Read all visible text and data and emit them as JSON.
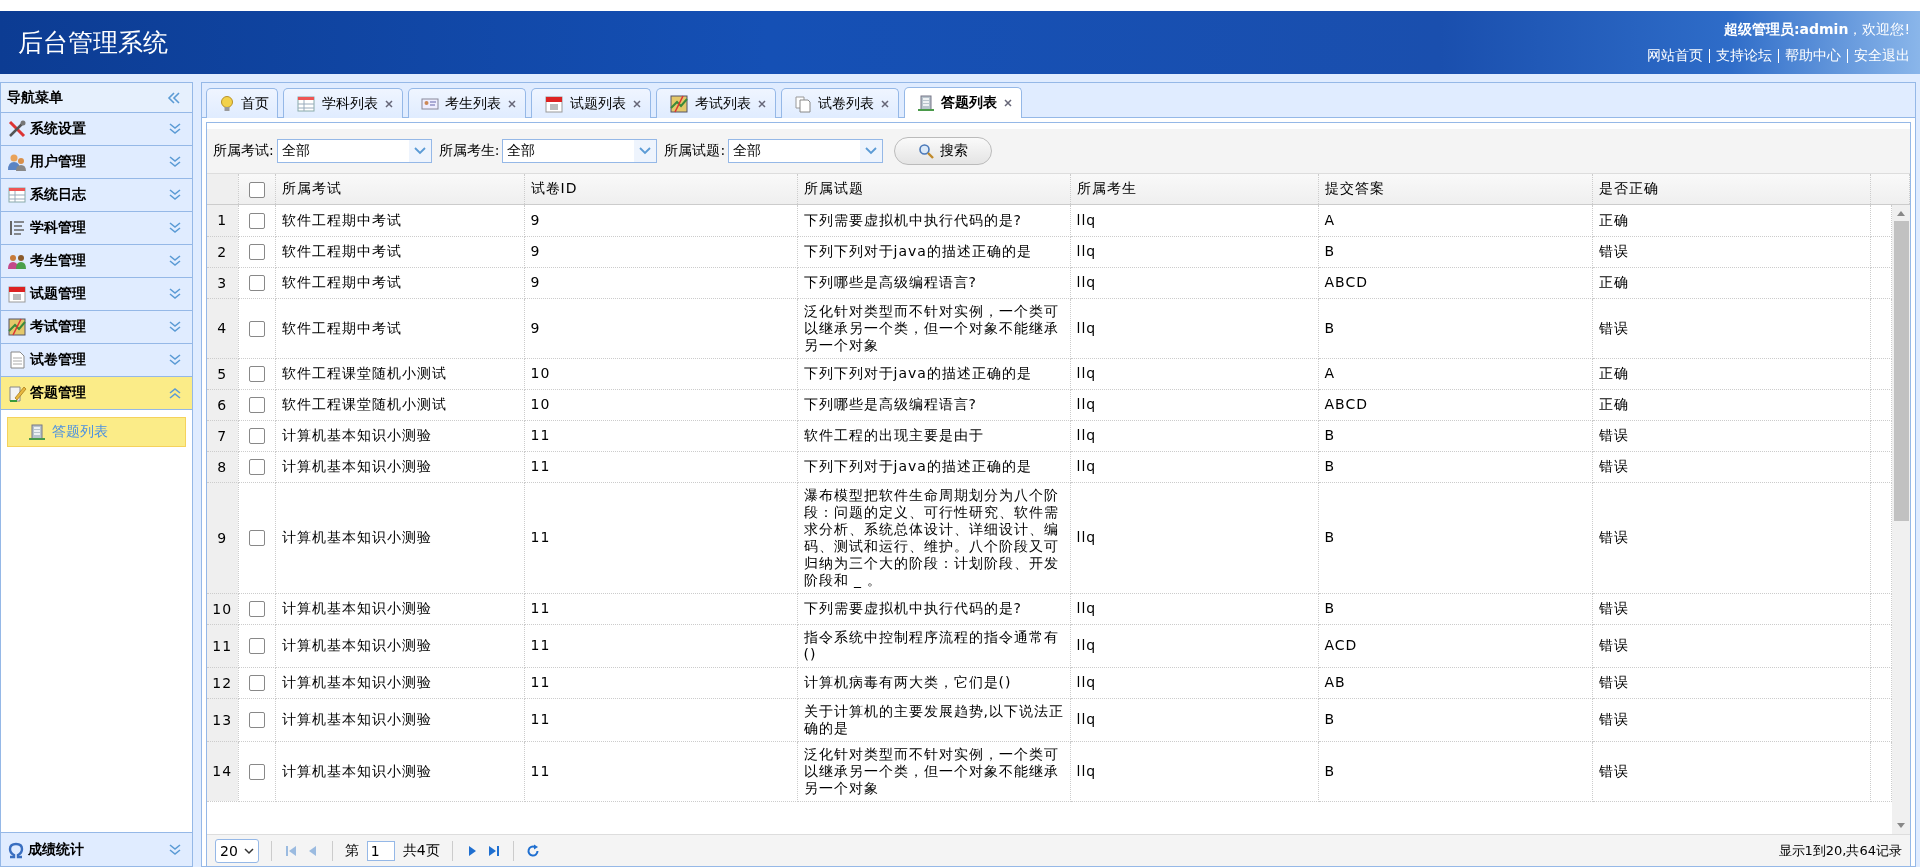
{
  "header": {
    "title": "后台管理系统",
    "greeting": "**超级管理员:admin**，欢迎您!",
    "links": [
      "网站首页",
      "支持论坛",
      "帮助中心",
      "安全退出"
    ]
  },
  "sidebar": {
    "title": "导航菜单",
    "items": [
      {
        "label": "系统设置",
        "expanded": false
      },
      {
        "label": "用户管理",
        "expanded": false
      },
      {
        "label": "系统日志",
        "expanded": false
      },
      {
        "label": "学科管理",
        "expanded": false
      },
      {
        "label": "考生管理",
        "expanded": false
      },
      {
        "label": "试题管理",
        "expanded": false
      },
      {
        "label": "考试管理",
        "expanded": false
      },
      {
        "label": "试卷管理",
        "expanded": false
      },
      {
        "label": "答题管理",
        "expanded": true,
        "children": [
          {
            "label": "答题列表",
            "selected": true
          }
        ]
      }
    ],
    "bottom_item": {
      "label": "成绩统计",
      "expanded": false
    }
  },
  "tabs": [
    {
      "label": "首页",
      "selected": false,
      "closable": false
    },
    {
      "label": "学科列表",
      "selected": false,
      "closable": true
    },
    {
      "label": "考生列表",
      "selected": false,
      "closable": true
    },
    {
      "label": "试题列表",
      "selected": false,
      "closable": true
    },
    {
      "label": "考试列表",
      "selected": false,
      "closable": true
    },
    {
      "label": "试卷列表",
      "selected": false,
      "closable": true
    },
    {
      "label": "答题列表",
      "selected": true,
      "closable": true
    }
  ],
  "filters": [
    {
      "label": "所属考试:",
      "value": "全部"
    },
    {
      "label": "所属考生:",
      "value": "全部"
    },
    {
      "label": "所属试题:",
      "value": "全部"
    }
  ],
  "search_button": "搜索",
  "table": {
    "header_checked": false,
    "columns": [
      "所属考试",
      "试卷ID",
      "所属试题",
      "所属考生",
      "提交答案",
      "是否正确"
    ],
    "rows": [
      {
        "number": "1",
        "checked": false,
        "cells": [
          "软件工程期中考试",
          "9",
          "下列需要虚拟机中执行代码的是?",
          "llq",
          "A",
          "正确"
        ]
      },
      {
        "number": "2",
        "checked": false,
        "cells": [
          "软件工程期中考试",
          "9",
          "下列下列对于java的描述正确的是",
          "llq",
          "B",
          "错误"
        ]
      },
      {
        "number": "3",
        "checked": false,
        "cells": [
          "软件工程期中考试",
          "9",
          "下列哪些是高级编程语言?",
          "llq",
          "ABCD",
          "正确"
        ]
      },
      {
        "number": "4",
        "checked": false,
        "cells": [
          "软件工程期中考试",
          "9",
          "泛化针对类型而不针对实例，一个类可以继承另一个类，但一个对象不能继承另一个对象",
          "llq",
          "B",
          "错误"
        ]
      },
      {
        "number": "5",
        "checked": false,
        "cells": [
          "软件工程课堂随机小测试",
          "10",
          "下列下列对于java的描述正确的是",
          "llq",
          "A",
          "正确"
        ]
      },
      {
        "number": "6",
        "checked": false,
        "cells": [
          "软件工程课堂随机小测试",
          "10",
          "下列哪些是高级编程语言?",
          "llq",
          "ABCD",
          "正确"
        ]
      },
      {
        "number": "7",
        "checked": false,
        "cells": [
          "计算机基本知识小测验",
          "11",
          "软件工程的出现主要是由于",
          "llq",
          "B",
          "错误"
        ]
      },
      {
        "number": "8",
        "checked": false,
        "cells": [
          "计算机基本知识小测验",
          "11",
          "下列下列对于java的描述正确的是",
          "llq",
          "B",
          "错误"
        ]
      },
      {
        "number": "9",
        "checked": false,
        "cells": [
          "计算机基本知识小测验",
          "11",
          "瀑布模型把软件生命周期划分为八个阶段：问题的定义、可行性研究、软件需求分析、系统总体设计、详细设计、编码、测试和运行、维护。八个阶段又可归纳为三个大的阶段：计划阶段、开发阶段和 _ 。",
          "llq",
          "B",
          "错误"
        ]
      },
      {
        "number": "10",
        "checked": false,
        "cells": [
          "计算机基本知识小测验",
          "11",
          "下列需要虚拟机中执行代码的是?",
          "llq",
          "B",
          "错误"
        ]
      },
      {
        "number": "11",
        "checked": false,
        "cells": [
          "计算机基本知识小测验",
          "11",
          "指令系统中控制程序流程的指令通常有()",
          "llq",
          "ACD",
          "错误"
        ]
      },
      {
        "number": "12",
        "checked": false,
        "cells": [
          "计算机基本知识小测验",
          "11",
          "计算机病毒有两大类，它们是()",
          "llq",
          "AB",
          "错误"
        ]
      },
      {
        "number": "13",
        "checked": false,
        "cells": [
          "计算机基本知识小测验",
          "11",
          "关于计算机的主要发展趋势,以下说法正确的是",
          "llq",
          "B",
          "错误"
        ]
      },
      {
        "number": "14",
        "checked": false,
        "cells": [
          "计算机基本知识小测验",
          "11",
          "泛化针对类型而不针对实例，一个类可以继承另一个类，但一个对象不能继承另一个对象",
          "llq",
          "B",
          "错误"
        ]
      }
    ]
  },
  "pager": {
    "page_size": "20",
    "page_prefix": "第",
    "page": "1",
    "total_pages": "共4页",
    "summary": "显示1到20,共64记录"
  }
}
